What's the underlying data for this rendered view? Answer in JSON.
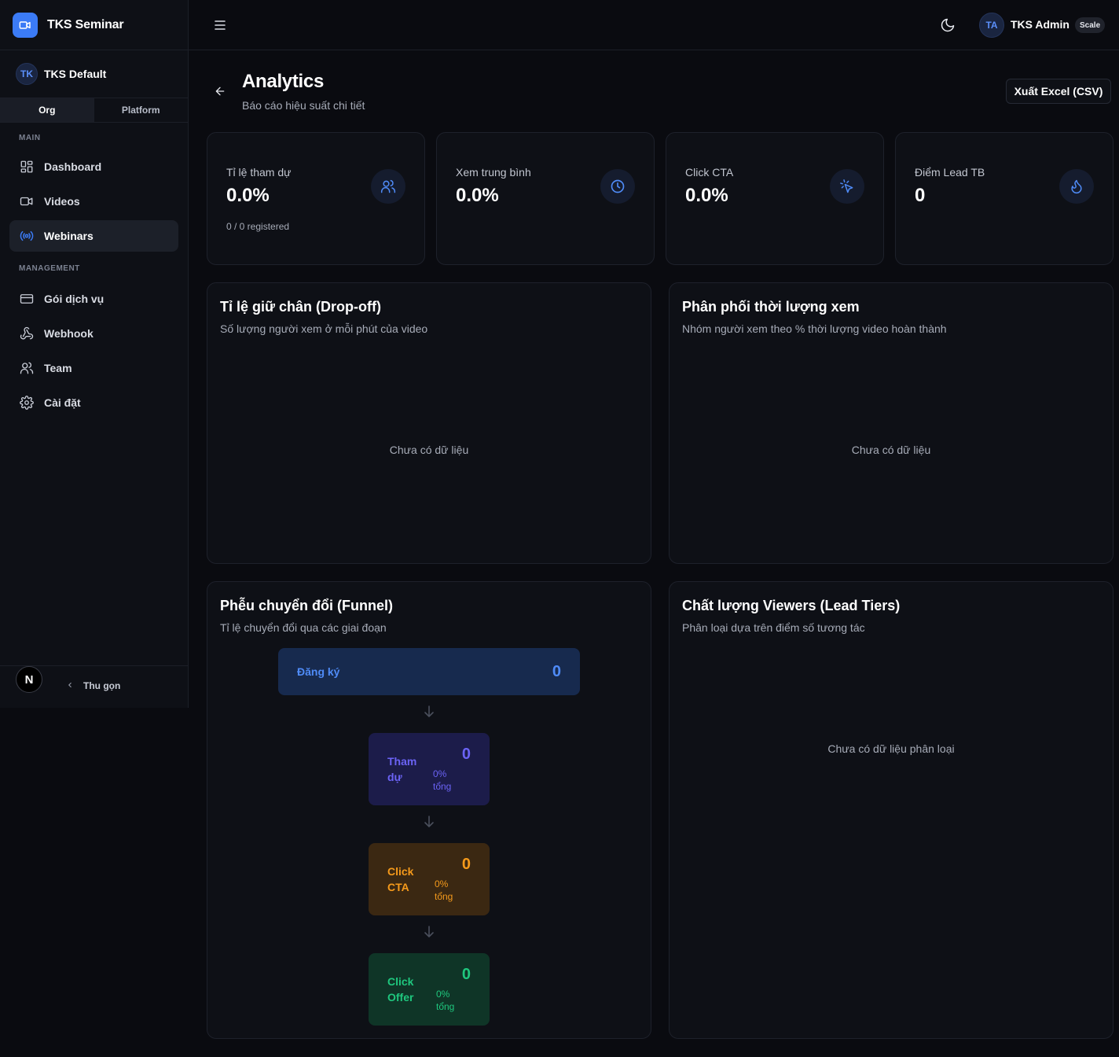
{
  "brand": {
    "name": "TKS Seminar",
    "icon": "video-camera-icon"
  },
  "org": {
    "initials": "TK",
    "name": "TKS Default"
  },
  "scope_tabs": [
    {
      "label": "Org",
      "active": true
    },
    {
      "label": "Platform",
      "active": false
    }
  ],
  "sidebar": {
    "main_label": "MAIN",
    "main_items": [
      {
        "label": "Dashboard",
        "icon": "grid-icon",
        "active": false
      },
      {
        "label": "Videos",
        "icon": "video-icon",
        "active": false
      },
      {
        "label": "Webinars",
        "icon": "broadcast-icon",
        "active": true
      }
    ],
    "management_label": "MANAGEMENT",
    "management_items": [
      {
        "label": "Gói dịch vụ",
        "icon": "credit-card-icon"
      },
      {
        "label": "Webhook",
        "icon": "webhook-icon"
      },
      {
        "label": "Team",
        "icon": "users-icon"
      },
      {
        "label": "Cài đặt",
        "icon": "settings-icon"
      }
    ],
    "collapse_label": "Thu gọn",
    "footer_logo": "N"
  },
  "topbar": {
    "user_initials": "TA",
    "user_name": "TKS Admin",
    "plan": "Scale"
  },
  "header": {
    "title": "Analytics",
    "subtitle": "Báo cáo hiệu suất chi tiết",
    "export_label": "Xuất Excel (CSV)"
  },
  "stats": [
    {
      "label": "Tỉ lệ tham dự",
      "value": "0.0%",
      "note": "0 / 0 registered",
      "icon": "users-icon"
    },
    {
      "label": "Xem trung bình",
      "value": "0.0%",
      "note": "",
      "icon": "clock-icon"
    },
    {
      "label": "Click CTA",
      "value": "0.0%",
      "note": "",
      "icon": "cursor-click-icon"
    },
    {
      "label": "Điểm Lead TB",
      "value": "0",
      "note": "",
      "icon": "flame-icon"
    }
  ],
  "panels": {
    "dropoff": {
      "title": "Tỉ lệ giữ chân (Drop-off)",
      "subtitle": "Số lượng người xem ở mỗi phút của video",
      "empty": "Chưa có dữ liệu"
    },
    "distribution": {
      "title": "Phân phối thời lượng xem",
      "subtitle": "Nhóm người xem theo % thời lượng video hoàn thành",
      "empty": "Chưa có dữ liệu"
    },
    "funnel": {
      "title": "Phễu chuyển đổi (Funnel)",
      "subtitle": "Tỉ lệ chuyển đổi qua các giai đoạn",
      "steps": [
        {
          "label": "Đăng ký",
          "value": "0",
          "pct": "",
          "color": "#4f8bf7"
        },
        {
          "label": "Tham dự",
          "value": "0",
          "pct": "0% tổng",
          "color": "#6b63f5"
        },
        {
          "label": "Click CTA",
          "value": "0",
          "pct": "0% tổng",
          "color": "#f59a1b"
        },
        {
          "label": "Click Offer",
          "value": "0",
          "pct": "0% tổng",
          "color": "#1fc77e"
        }
      ]
    },
    "lead_tiers": {
      "title": "Chất lượng Viewers (Lead Tiers)",
      "subtitle": "Phân loại dựa trên điểm số tương tác",
      "empty": "Chưa có dữ liệu phân loại"
    }
  },
  "colors": {
    "accent": "#3b7bf6",
    "background": "#0a0b10",
    "card": "#0e1016"
  }
}
